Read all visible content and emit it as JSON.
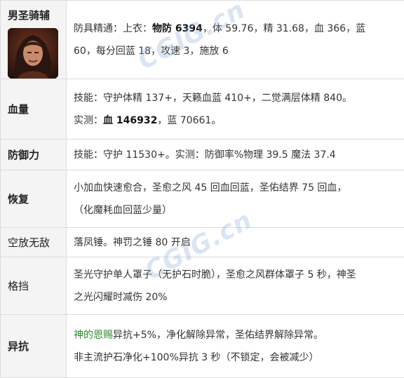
{
  "rows": {
    "r1": {
      "label": "男圣骑辅",
      "l1_a": "防具精通：上衣：",
      "l1_b": "物防 6394",
      "l1_c": "，体 59.76，精 31.68，血 366，蓝",
      "l2": "60，每分回蓝 18，攻速 3，施放 6"
    },
    "r2": {
      "label": "血量",
      "l1": "技能：守护体精 137+，天籁血蓝 410+，二觉满层体精 840。",
      "l2_a": "实测：",
      "l2_b": "血 146932",
      "l2_c": "，蓝 70661。"
    },
    "r3": {
      "label": "防御力",
      "l1": "技能：守护 11530+。实测：防御率%物理 39.5 魔法 37.4"
    },
    "r4": {
      "label": "恢复",
      "l1": "小加血快速愈合，圣愈之风 45 回血回蓝，圣佑结界 75 回血，",
      "l2": "（化魔耗血回蓝少量）"
    },
    "r5": {
      "label": "空放无敌",
      "l1": "落凤锤。神罚之锤 80 开启"
    },
    "r6": {
      "label": "格挡",
      "l1": "圣光守护单人罩子（无护石时脆），圣愈之风群体罩子 5 秒，神圣",
      "l2": "之光闪耀时减伤 20%"
    },
    "r7": {
      "label": "异抗",
      "l1_a": "神的恩赐",
      "l1_b": "异抗+5%，净化解除异常，圣佑结界解除异常。",
      "l2": "非主流护石净化+100%异抗 3 秒（不锁定，会被减少）"
    }
  },
  "watermark": "CGIG.cn",
  "colors": {
    "highlight_green": "#2e8b2e",
    "label_bg": "#f4f4f4",
    "border": "#dcdcdc"
  }
}
